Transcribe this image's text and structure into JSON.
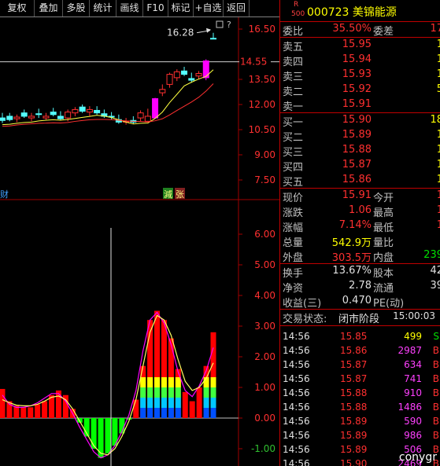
{
  "toolbar": [
    {
      "label": "复权",
      "w": 44
    },
    {
      "label": "叠加",
      "w": 36
    },
    {
      "label": "多股",
      "w": 34
    },
    {
      "label": "统计",
      "w": 34
    },
    {
      "label": "画线",
      "w": 34
    },
    {
      "label": "F10",
      "w": 32
    },
    {
      "label": "标记",
      "w": 32
    },
    {
      "label": "+自选",
      "w": 38
    },
    {
      "label": "返回",
      "w": 33
    }
  ],
  "kline": {
    "axis_labels": [
      "16.50",
      "13.50",
      "12.00",
      "10.50",
      "9.00",
      "7.50"
    ],
    "current_price_tag": "14.55",
    "high_annotation": "16.28",
    "markers": {
      "left": "财",
      "reduce": "減",
      "up": "张"
    },
    "candles": [
      {
        "o": 11.2,
        "h": 11.5,
        "l": 10.9,
        "c": 11.05
      },
      {
        "o": 11.3,
        "h": 11.5,
        "l": 11.0,
        "c": 11.1
      },
      {
        "o": 11.15,
        "h": 11.4,
        "l": 10.95,
        "c": 11.25
      },
      {
        "o": 11.5,
        "h": 11.7,
        "l": 11.2,
        "c": 11.3
      },
      {
        "o": 11.2,
        "h": 11.5,
        "l": 11.0,
        "c": 11.3
      },
      {
        "o": 11.45,
        "h": 11.75,
        "l": 11.2,
        "c": 11.4
      },
      {
        "o": 11.2,
        "h": 11.5,
        "l": 11.1,
        "c": 11.3
      },
      {
        "o": 11.55,
        "h": 11.8,
        "l": 11.3,
        "c": 11.4
      },
      {
        "o": 11.3,
        "h": 11.6,
        "l": 11.05,
        "c": 11.15
      },
      {
        "o": 11.2,
        "h": 11.7,
        "l": 11.0,
        "c": 11.55
      },
      {
        "o": 11.5,
        "h": 11.85,
        "l": 11.3,
        "c": 11.7
      },
      {
        "o": 11.85,
        "h": 12.0,
        "l": 11.5,
        "c": 11.6
      },
      {
        "o": 11.55,
        "h": 11.9,
        "l": 11.3,
        "c": 11.7
      },
      {
        "o": 11.65,
        "h": 11.9,
        "l": 11.4,
        "c": 11.5
      },
      {
        "o": 11.45,
        "h": 11.7,
        "l": 11.2,
        "c": 11.3
      },
      {
        "o": 11.3,
        "h": 11.55,
        "l": 11.1,
        "c": 11.25
      },
      {
        "o": 11.1,
        "h": 11.4,
        "l": 10.85,
        "c": 10.95
      },
      {
        "o": 10.95,
        "h": 11.2,
        "l": 10.8,
        "c": 11.0
      },
      {
        "o": 11.05,
        "h": 11.3,
        "l": 10.85,
        "c": 10.95
      },
      {
        "o": 11.2,
        "h": 11.65,
        "l": 11.0,
        "c": 11.5
      },
      {
        "o": 11.0,
        "h": 11.75,
        "l": 10.95,
        "c": 11.3
      },
      {
        "o": 11.2,
        "h": 12.4,
        "l": 11.15,
        "c": 12.35
      },
      {
        "o": 12.7,
        "h": 13.2,
        "l": 12.5,
        "c": 12.9
      },
      {
        "o": 13.2,
        "h": 13.9,
        "l": 13.0,
        "c": 13.8
      },
      {
        "o": 13.6,
        "h": 14.1,
        "l": 13.4,
        "c": 13.95
      },
      {
        "o": 14.0,
        "h": 14.25,
        "l": 13.7,
        "c": 13.8
      },
      {
        "o": 13.55,
        "h": 13.9,
        "l": 13.3,
        "c": 13.45
      },
      {
        "o": 13.7,
        "h": 14.0,
        "l": 13.5,
        "c": 13.85
      },
      {
        "o": 13.6,
        "h": 14.7,
        "l": 13.45,
        "c": 14.6
      },
      {
        "o": 15.95,
        "h": 16.28,
        "l": 15.9,
        "c": 15.91
      }
    ]
  },
  "macd": {
    "axis_labels": [
      "6.00",
      "5.00",
      "4.00",
      "3.00",
      "2.00",
      "1.00",
      "0.00",
      "-1.00"
    ],
    "bars": [
      0.95,
      0.55,
      0.4,
      0.35,
      0.35,
      0.45,
      0.55,
      0.75,
      0.9,
      0.75,
      0.3,
      -0.15,
      -0.6,
      -1.0,
      -1.3,
      -1.15,
      -0.9,
      -0.5,
      -0.05,
      0.6,
      1.7,
      3.2,
      3.5,
      3.2,
      2.6,
      1.6,
      0.85,
      0.55,
      1.0,
      1.7,
      2.8
    ],
    "line1": [
      0.75,
      0.45,
      0.35,
      0.35,
      0.4,
      0.5,
      0.65,
      0.8,
      0.8,
      0.55,
      0.15,
      -0.3,
      -0.7,
      -1.1,
      -1.3,
      -1.2,
      -0.9,
      -0.45,
      0.1,
      0.9,
      2.2,
      3.2,
      3.45,
      3.1,
      2.4,
      1.5,
      0.9,
      0.7,
      1.05,
      1.55,
      2.3
    ],
    "line2": [
      0.6,
      0.5,
      0.42,
      0.4,
      0.4,
      0.45,
      0.55,
      0.68,
      0.72,
      0.6,
      0.3,
      -0.1,
      -0.5,
      -0.9,
      -1.15,
      -1.2,
      -1.0,
      -0.6,
      -0.1,
      0.6,
      1.7,
      2.8,
      3.35,
      3.2,
      2.7,
      1.9,
      1.2,
      0.9,
      1.0,
      1.3,
      1.8
    ]
  },
  "panel": {
    "r_mark": "R",
    "r_num": "500",
    "stock_title": "000723 美锦能源",
    "weibi": {
      "label": "委比",
      "value": "35.50%",
      "label2": "委差",
      "value2": "17"
    },
    "asks": [
      {
        "label": "卖五",
        "price": "15.95",
        "vol": "1"
      },
      {
        "label": "卖四",
        "price": "15.94",
        "vol": "1"
      },
      {
        "label": "卖三",
        "price": "15.93",
        "vol": "1"
      },
      {
        "label": "卖二",
        "price": "15.92",
        "vol": "5"
      },
      {
        "label": "卖一",
        "price": "15.91",
        "vol": ""
      }
    ],
    "bids": [
      {
        "label": "买一",
        "price": "15.90",
        "vol": "18"
      },
      {
        "label": "买二",
        "price": "15.89",
        "vol": "1"
      },
      {
        "label": "买三",
        "price": "15.88",
        "vol": "1"
      },
      {
        "label": "买四",
        "price": "15.87",
        "vol": "1"
      },
      {
        "label": "买五",
        "price": "15.86",
        "vol": "1"
      }
    ],
    "quote": [
      {
        "l1": "现价",
        "v1": "15.91",
        "c1": "red",
        "l2": "今开",
        "v2": "1",
        "c2": "red"
      },
      {
        "l1": "涨跌",
        "v1": "1.06",
        "c1": "red",
        "l2": "最高",
        "v2": "1",
        "c2": "red"
      },
      {
        "l1": "涨幅",
        "v1": "7.14%",
        "c1": "red",
        "l2": "最低",
        "v2": "1",
        "c2": "red"
      },
      {
        "l1": "总量",
        "v1": "542.9万",
        "c1": "yellow",
        "l2": "量比",
        "v2": "",
        "c2": "white"
      },
      {
        "l1": "外盘",
        "v1": "303.5万",
        "c1": "red",
        "l2": "内盘",
        "v2": "239",
        "c2": "green"
      }
    ],
    "fundamentals": [
      {
        "l1": "换手",
        "v1": "13.67%",
        "l2": "股本",
        "v2": "42"
      },
      {
        "l1": "净资",
        "v1": "2.78",
        "l2": "流通",
        "v2": "39"
      },
      {
        "l1": "收益(三)",
        "v1": "0.470",
        "l2": "PE(动)",
        "v2": ""
      }
    ],
    "status": {
      "label": "交易状态:",
      "value": "闭市阶段",
      "time": "15:00:03"
    },
    "trades": [
      {
        "time": "14:56",
        "price": "15.85",
        "vol": "499",
        "side": "S",
        "vol_color": "#ffff00",
        "side_color": "#00e000"
      },
      {
        "time": "14:56",
        "price": "15.86",
        "vol": "2987",
        "side": "B",
        "vol_color": "#ff40ff",
        "side_color": "#ff3030"
      },
      {
        "time": "14:56",
        "price": "15.87",
        "vol": "634",
        "side": "B",
        "vol_color": "#ff40ff",
        "side_color": "#ff3030"
      },
      {
        "time": "14:56",
        "price": "15.87",
        "vol": "741",
        "side": "B",
        "vol_color": "#ff40ff",
        "side_color": "#ff3030"
      },
      {
        "time": "14:56",
        "price": "15.88",
        "vol": "910",
        "side": "B",
        "vol_color": "#ff40ff",
        "side_color": "#ff3030"
      },
      {
        "time": "14:56",
        "price": "15.88",
        "vol": "1486",
        "side": "B",
        "vol_color": "#ff40ff",
        "side_color": "#ff3030"
      },
      {
        "time": "14:56",
        "price": "15.89",
        "vol": "590",
        "side": "B",
        "vol_color": "#ff40ff",
        "side_color": "#ff3030"
      },
      {
        "time": "14:56",
        "price": "15.89",
        "vol": "986",
        "side": "B",
        "vol_color": "#ff40ff",
        "side_color": "#ff3030"
      },
      {
        "time": "14:56",
        "price": "15.89",
        "vol": "506",
        "side": "B",
        "vol_color": "#ff40ff",
        "side_color": "#ff3030"
      },
      {
        "time": "14:56",
        "price": "15.90",
        "vol": "2469",
        "side": "B",
        "vol_color": "#ff40ff",
        "side_color": "#ff3030"
      }
    ],
    "watermark": "conygr"
  }
}
